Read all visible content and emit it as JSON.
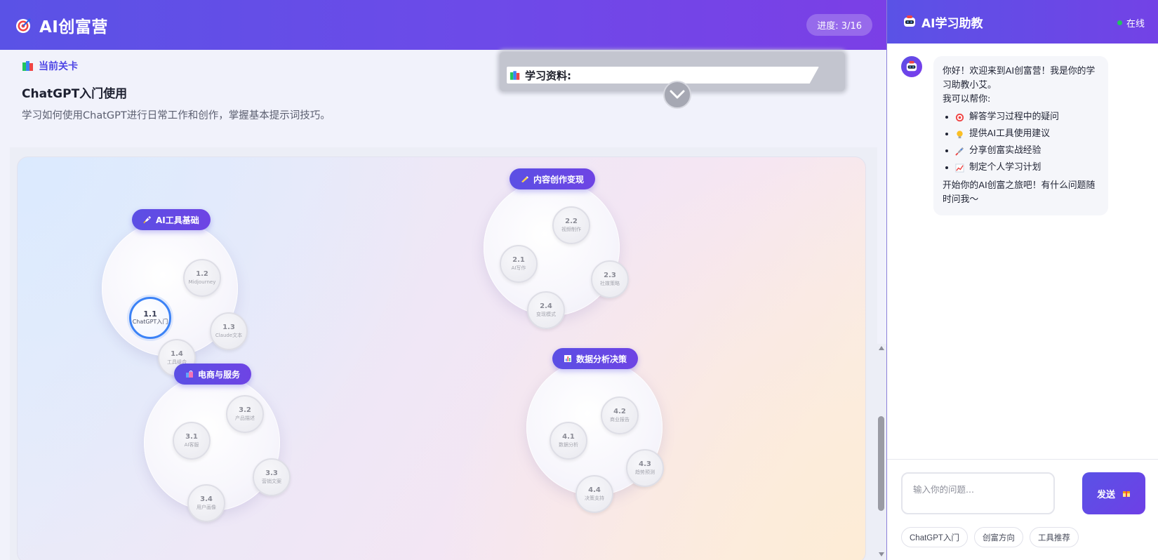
{
  "app": {
    "title": "AI创富营",
    "progress": "进度: 3/16"
  },
  "current_level": {
    "tag": "当前关卡",
    "title": "ChatGPT入门使用",
    "description": "学习如何使用ChatGPT进行日常工作和创作，掌握基本提示词技巧。"
  },
  "materials": {
    "label": "学习资料:"
  },
  "stages": [
    {
      "title": "AI工具基础",
      "icon": "rocket-icon",
      "nodes": [
        {
          "num": "1.1",
          "name": "ChatGPT入门",
          "active": true
        },
        {
          "num": "1.2",
          "name": "Midjourney"
        },
        {
          "num": "1.3",
          "name": "Claude文本"
        },
        {
          "num": "1.4",
          "name": "工具组合"
        }
      ]
    },
    {
      "title": "内容创作变现",
      "icon": "writing-hand-icon",
      "nodes": [
        {
          "num": "2.1",
          "name": "AI写作"
        },
        {
          "num": "2.2",
          "name": "视频制作"
        },
        {
          "num": "2.3",
          "name": "社媒策略"
        },
        {
          "num": "2.4",
          "name": "变现模式"
        }
      ]
    },
    {
      "title": "电商与服务",
      "icon": "shopping-bags-icon",
      "nodes": [
        {
          "num": "3.1",
          "name": "AI客服"
        },
        {
          "num": "3.2",
          "name": "产品描述"
        },
        {
          "num": "3.3",
          "name": "营销文案"
        },
        {
          "num": "3.4",
          "name": "用户画像"
        }
      ]
    },
    {
      "title": "数据分析决策",
      "icon": "bar-chart-icon",
      "nodes": [
        {
          "num": "4.1",
          "name": "数据分析"
        },
        {
          "num": "4.2",
          "name": "商业报告"
        },
        {
          "num": "4.3",
          "name": "趋势预测"
        },
        {
          "num": "4.4",
          "name": "决策支持"
        }
      ]
    }
  ],
  "chat": {
    "title": "AI学习助教",
    "status": "在线",
    "message": {
      "intro": "你好！欢迎来到AI创富营！我是你的学习助教小艾。",
      "can_help": "我可以帮你:",
      "items": [
        {
          "icon": "target-icon",
          "text": "解答学习过程中的疑问"
        },
        {
          "icon": "lightbulb-icon",
          "text": "提供AI工具使用建议"
        },
        {
          "icon": "rocket-icon",
          "text": "分享创富实战经验"
        },
        {
          "icon": "chart-up-icon",
          "text": "制定个人学习计划"
        }
      ],
      "closing": "开始你的AI创富之旅吧！有什么问题随时问我～"
    },
    "input_placeholder": "输入你的问题...",
    "send_label": "发送",
    "quick_buttons": [
      "ChatGPT入门",
      "创富方向",
      "工具推荐"
    ]
  },
  "colors": {
    "brand_primary": "#5a52e6",
    "brand_secondary": "#7b3fe6",
    "active_node": "#3b82f6",
    "online": "#22c55e"
  }
}
